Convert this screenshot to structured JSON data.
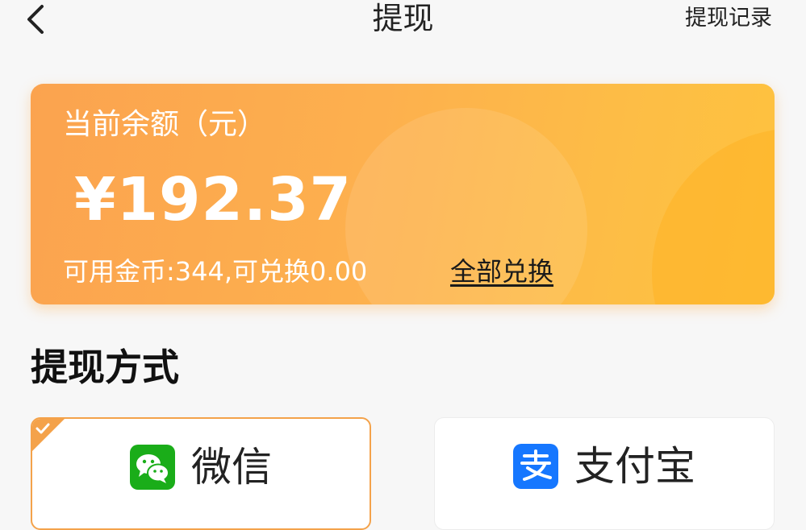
{
  "header": {
    "title": "提现",
    "history_label": "提现记录"
  },
  "balance_card": {
    "label": "当前余额（元）",
    "amount": "¥192.37",
    "coins_text": "可用金币:344,可兑换0.00",
    "exchange_all_label": "全部兑换"
  },
  "section": {
    "title": "提现方式"
  },
  "methods": [
    {
      "label": "微信",
      "icon": "wechat-icon",
      "selected": true
    },
    {
      "label": "支付宝",
      "icon": "alipay-icon",
      "selected": false
    }
  ],
  "colors": {
    "accent": "#f4a24a",
    "card_gradient_start": "#fba34f",
    "card_gradient_end": "#fec23e",
    "wechat_green": "#1aad19",
    "alipay_blue": "#1677ff"
  }
}
